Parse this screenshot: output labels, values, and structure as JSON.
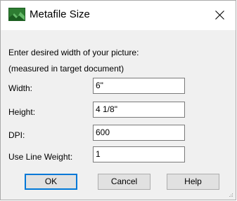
{
  "window": {
    "title": "Metafile Size",
    "close_glyph": "✕",
    "icon": "app-icon"
  },
  "instructions": {
    "line1": "Enter desired width of your picture:",
    "line2": "(measured in target document)"
  },
  "fields": [
    {
      "label": "Width:",
      "value": "6\""
    },
    {
      "label": "Height:",
      "value": "4 1/8\""
    },
    {
      "label": "DPI:",
      "value": "600"
    },
    {
      "label": "Use Line Weight:",
      "value": "1"
    }
  ],
  "buttons": {
    "ok": "OK",
    "cancel": "Cancel",
    "help": "Help"
  },
  "colors": {
    "dialog_bg": "#f0f0f0",
    "default_button_border": "#0078d7",
    "icon_green": "#2e7d32"
  }
}
